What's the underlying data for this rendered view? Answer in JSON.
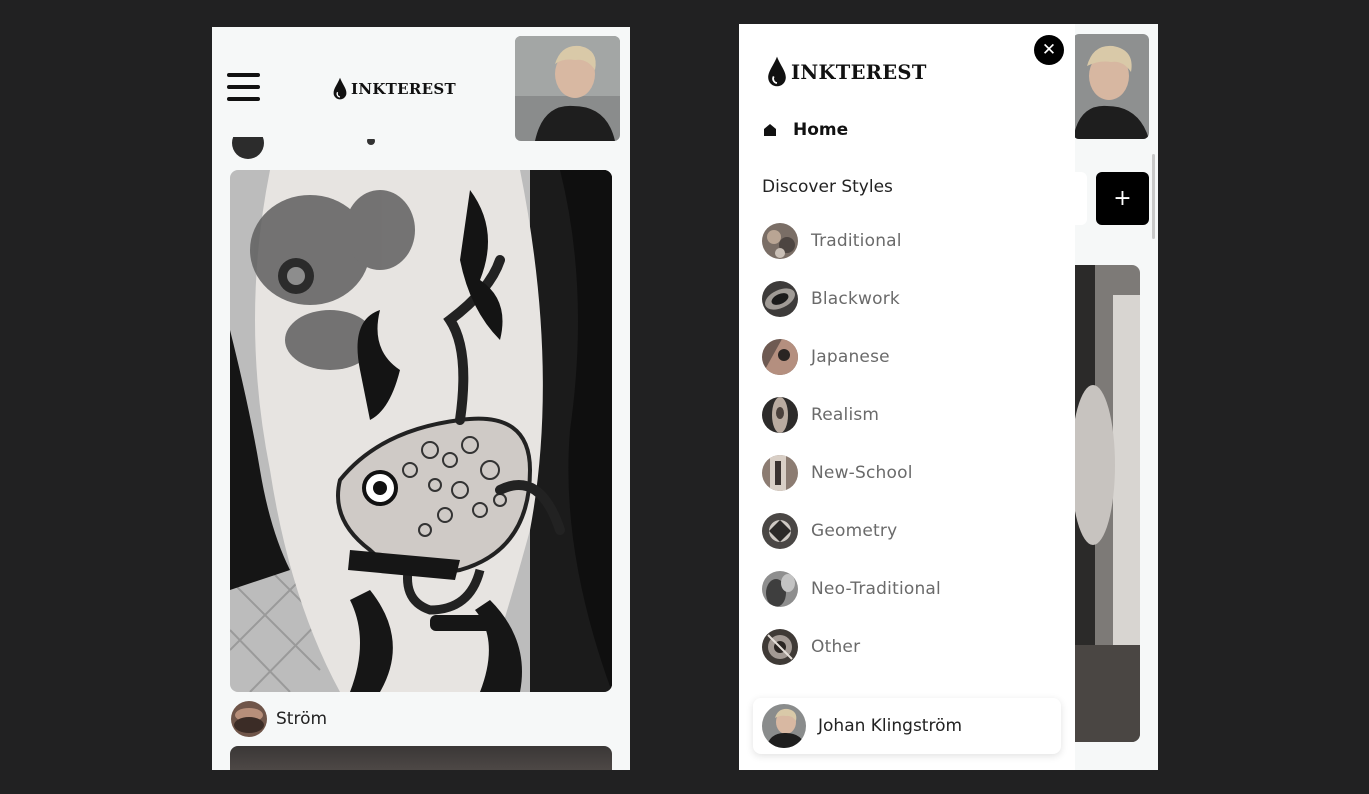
{
  "brand": {
    "name": "INKTEREST"
  },
  "left_screen": {
    "feed_author": "Ström"
  },
  "right_screen": {
    "add_button_label": "+",
    "close_label": "✕",
    "nav": {
      "home_label": "Home",
      "section_title": "Discover Styles",
      "styles": [
        {
          "label": "Traditional",
          "tone": "#7a6e66"
        },
        {
          "label": "Blackwork",
          "tone": "#3d3b3a"
        },
        {
          "label": "Japanese",
          "tone": "#6e5a52"
        },
        {
          "label": "Realism",
          "tone": "#2d2b2a"
        },
        {
          "label": "New-School",
          "tone": "#8c7c72"
        },
        {
          "label": "Geometry",
          "tone": "#4a4745"
        },
        {
          "label": "Neo-Traditional",
          "tone": "#8e8e8e"
        },
        {
          "label": "Other",
          "tone": "#3f3a36"
        }
      ]
    },
    "profile": {
      "name": "Johan Klingström"
    }
  }
}
